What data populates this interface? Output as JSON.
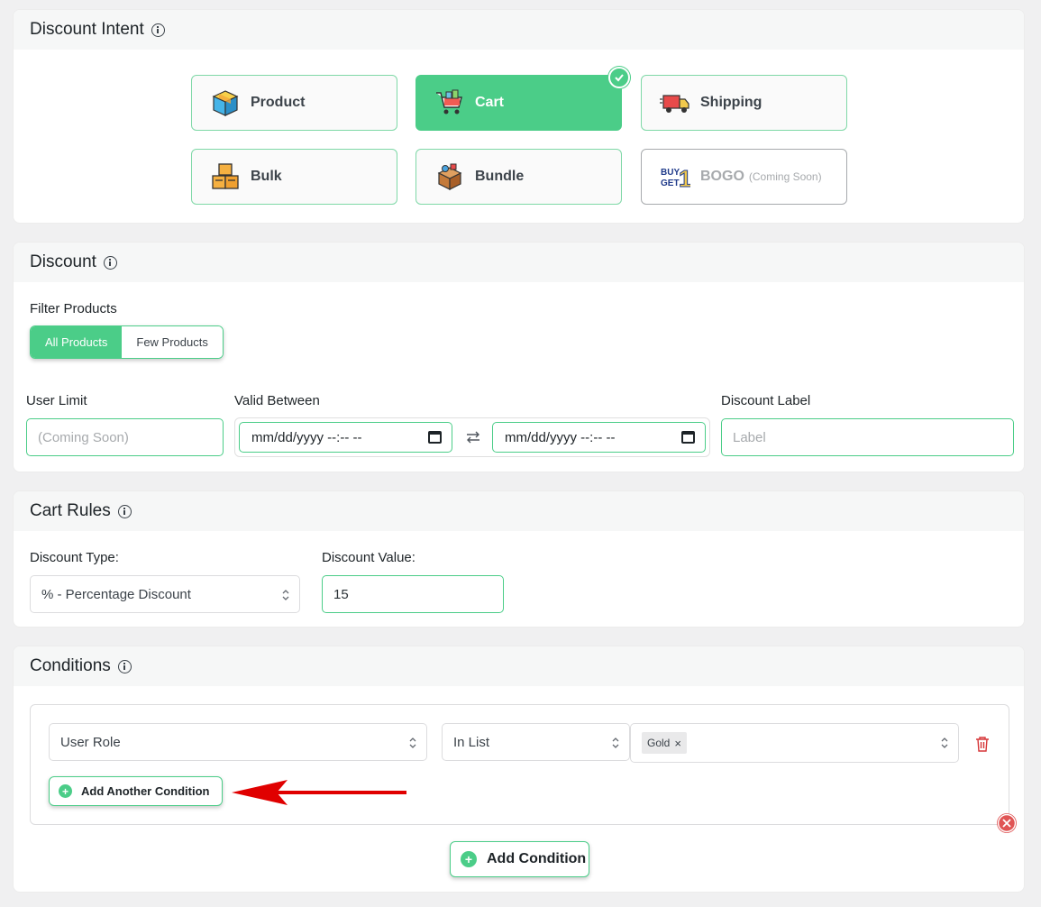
{
  "discount_intent": {
    "title": "Discount Intent",
    "options": [
      {
        "label": "Product",
        "icon": "box-icon",
        "state": "default"
      },
      {
        "label": "Cart",
        "icon": "shopping-cart-icon",
        "state": "selected"
      },
      {
        "label": "Shipping",
        "icon": "delivery-truck-icon",
        "state": "default"
      },
      {
        "label": "Bulk",
        "icon": "stacked-boxes-icon",
        "state": "default"
      },
      {
        "label": "Bundle",
        "icon": "bundle-box-icon",
        "state": "default"
      },
      {
        "label": "BOGO",
        "suffix": "(Coming Soon)",
        "icon": "buy-get-1-icon",
        "state": "disabled"
      }
    ],
    "bogo_icon_text": {
      "line1": "BUY",
      "line2": "GET",
      "digit": "1"
    }
  },
  "discount": {
    "title": "Discount",
    "filter_products_label": "Filter Products",
    "filter_options": [
      "All Products",
      "Few Products"
    ],
    "filter_selected": "All Products",
    "user_limit_label": "User Limit",
    "user_limit_placeholder": "(Coming Soon)",
    "valid_between_label": "Valid Between",
    "date_start_placeholder": "mm/dd/yyyy --:-- --",
    "date_end_placeholder": "mm/dd/yyyy --:-- --",
    "discount_label_label": "Discount Label",
    "discount_label_placeholder": "Label"
  },
  "cart_rules": {
    "title": "Cart Rules",
    "discount_type_label": "Discount Type:",
    "discount_type_value": "% - Percentage Discount",
    "discount_value_label": "Discount Value:",
    "discount_value": "15"
  },
  "conditions": {
    "title": "Conditions",
    "rows": [
      {
        "field": "User Role",
        "operator": "In List",
        "values": [
          "Gold"
        ]
      }
    ],
    "add_another_label": "Add Another Condition",
    "add_condition_label": "Add Condition"
  },
  "colors": {
    "accent": "#4bcd88",
    "annotation_arrow": "#e00000",
    "delete": "#d63638"
  }
}
